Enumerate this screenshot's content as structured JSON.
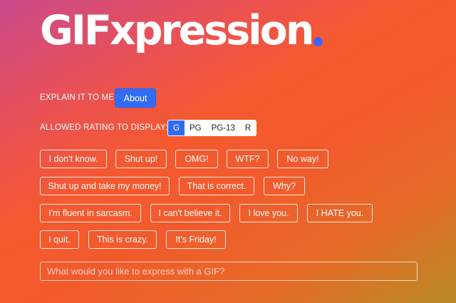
{
  "logo": {
    "text": "GIFxpression",
    "dot_color": "#3d63ff"
  },
  "explain": {
    "label": "EXPLAIN IT TO ME:",
    "button_label": "About"
  },
  "rating": {
    "label": "ALLOWED RATING TO DISPLAY:",
    "options": [
      "G",
      "PG",
      "PG-13",
      "R"
    ],
    "selected": "G"
  },
  "phrases": [
    "I don't know.",
    "Shut up!",
    "OMG!",
    "WTF?",
    "No way!",
    "Shut up and take my money!",
    "That is correct.",
    "Why?",
    "I'm fluent in sarcasm.",
    "I can't believe it.",
    "I love you.",
    "I HATE you.",
    "I quit.",
    "This is crazy.",
    "It's Friday!"
  ],
  "search": {
    "placeholder": "What would you like to express with a GIF?",
    "value": ""
  },
  "colors": {
    "accent": "#2f6df6",
    "background_start": "#c94a8c",
    "background_mid": "#f5592f",
    "background_end": "#b88a24"
  }
}
